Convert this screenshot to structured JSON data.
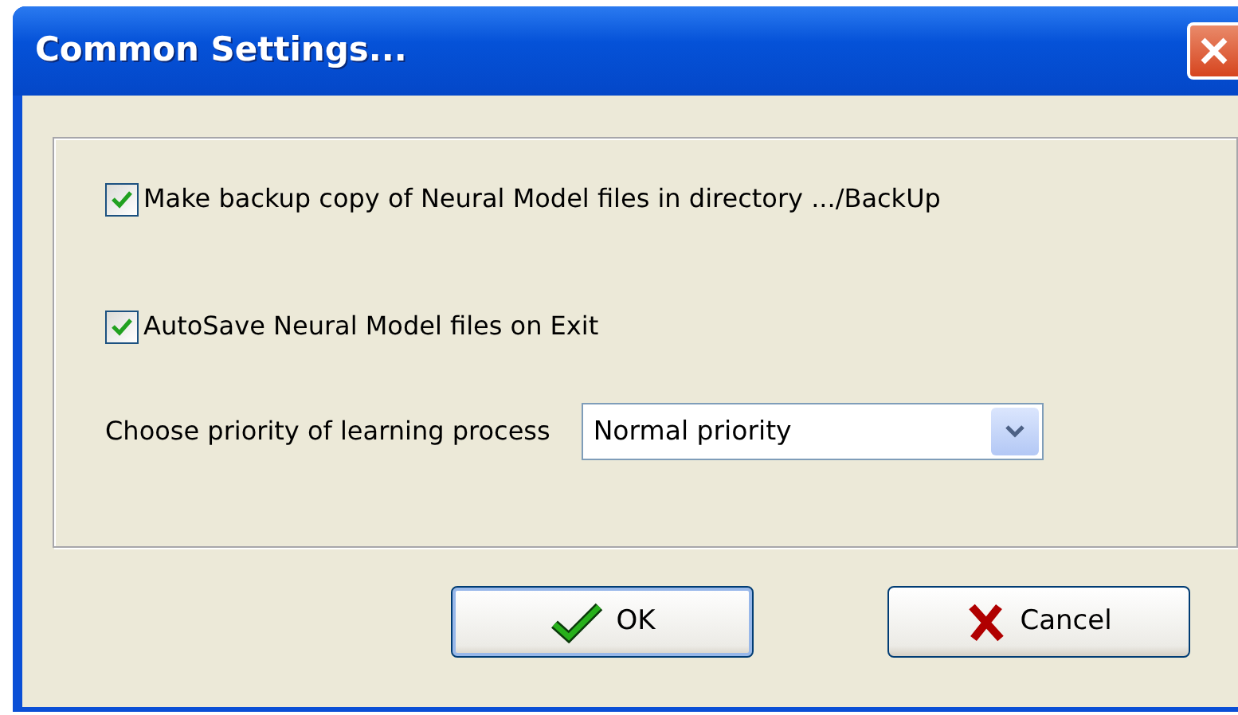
{
  "window": {
    "title": "Common Settings..."
  },
  "options": [
    {
      "label": "Make backup copy of Neural Model files in directory .../BackUp",
      "checked": true
    },
    {
      "label": "AutoSave Neural Model files on Exit",
      "checked": true
    }
  ],
  "priority": {
    "label": "Choose priority of learning process",
    "value": "Normal priority"
  },
  "buttons": [
    {
      "label": "OK",
      "kind": "ok",
      "default": true
    },
    {
      "label": "Cancel",
      "kind": "cancel",
      "default": false
    }
  ]
}
